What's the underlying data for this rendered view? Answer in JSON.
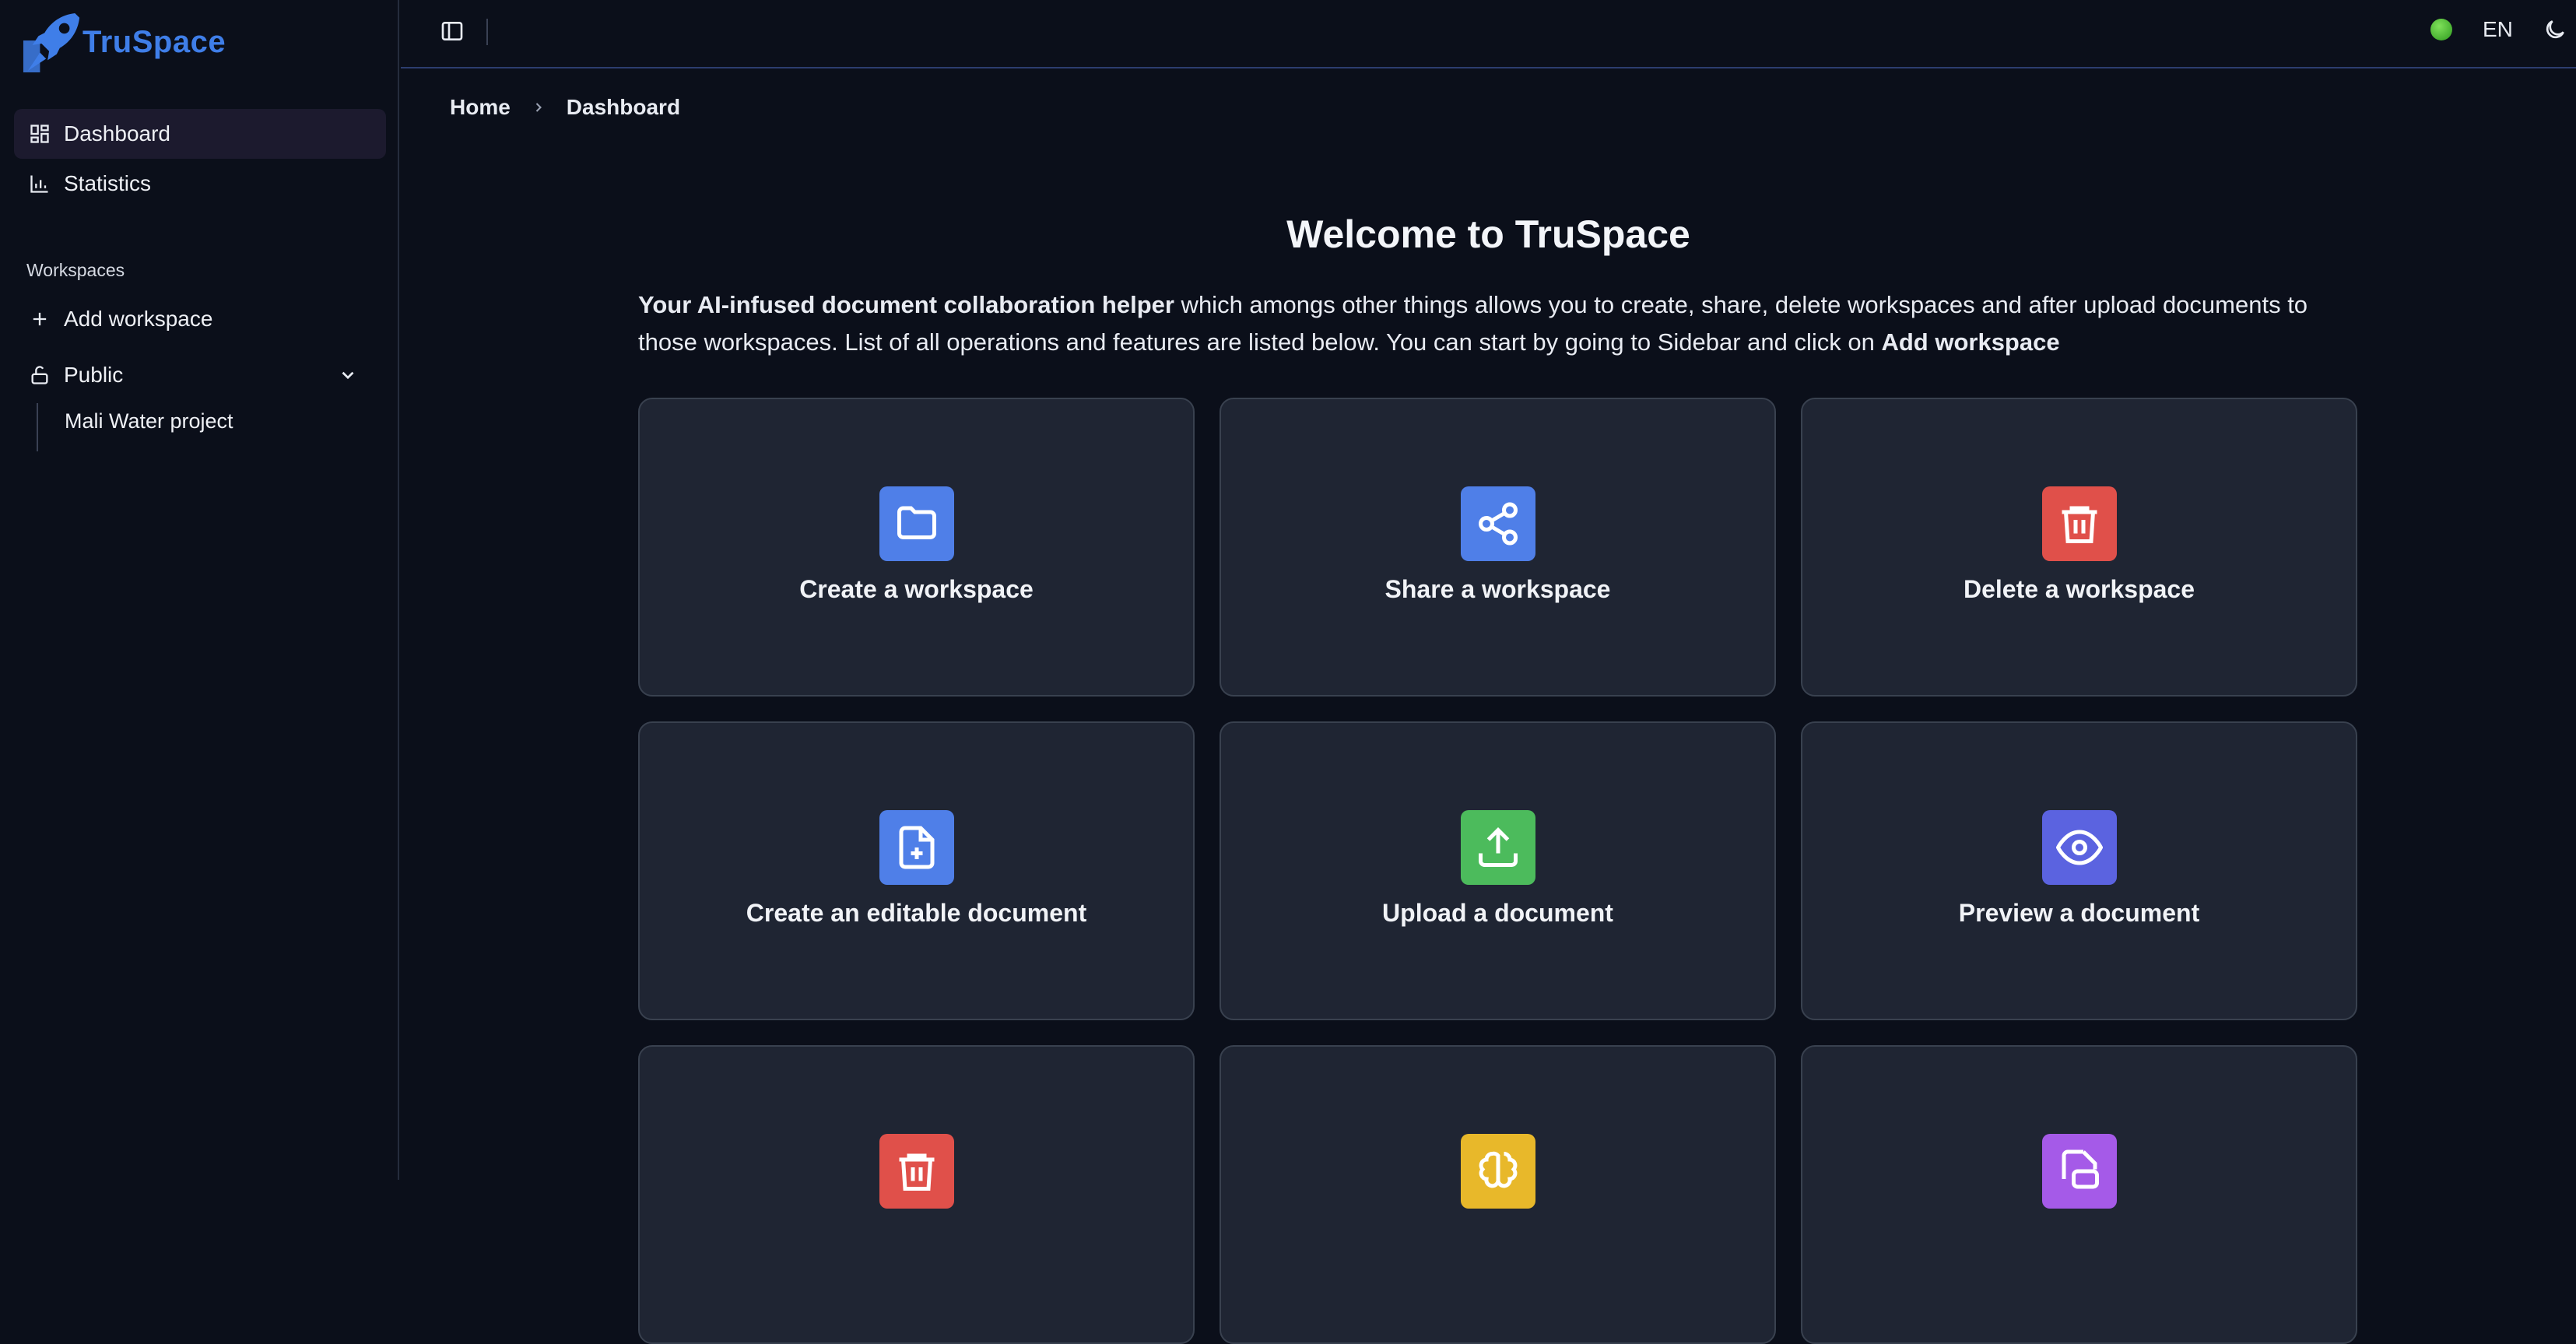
{
  "app": {
    "name": "TruSpace"
  },
  "sidebar": {
    "items": [
      {
        "label": "Dashboard",
        "icon": "dashboard-icon",
        "active": true
      },
      {
        "label": "Statistics",
        "icon": "bar-chart-icon",
        "active": false
      }
    ],
    "section_label": "Workspaces",
    "add_workspace": "Add workspace",
    "public_group": "Public",
    "public_children": [
      "Mali Water project"
    ]
  },
  "topbar": {
    "status_color": "#4caf3a",
    "language": "EN"
  },
  "breadcrumb": {
    "home": "Home",
    "current": "Dashboard"
  },
  "main": {
    "title": "Welcome to TruSpace",
    "intro_bold": "Your AI-infused document collaboration helper",
    "intro_text": " which amongs other things allows you to create, share, delete workspaces and after upload documents to those workspaces. List of all operations and features are listed below. You can start by going to Sidebar and click on ",
    "intro_bold_end": "Add workspace",
    "cards": [
      {
        "label": "Create a workspace",
        "icon": "folder-icon",
        "color": "#4f7fe8"
      },
      {
        "label": "Share a workspace",
        "icon": "share-icon",
        "color": "#4f7fe8"
      },
      {
        "label": "Delete a workspace",
        "icon": "trash-icon",
        "color": "#e0504a"
      },
      {
        "label": "Create an editable document",
        "icon": "file-plus-icon",
        "color": "#4f7fe8"
      },
      {
        "label": "Upload a document",
        "icon": "upload-icon",
        "color": "#4cbb5c"
      },
      {
        "label": "Preview a document",
        "icon": "eye-icon",
        "color": "#5b63e0"
      },
      {
        "label": "",
        "icon": "trash-icon",
        "color": "#e0504a"
      },
      {
        "label": "",
        "icon": "brain-icon",
        "color": "#e8b82a"
      },
      {
        "label": "",
        "icon": "file-chat-icon",
        "color": "#a55ae8"
      }
    ]
  }
}
